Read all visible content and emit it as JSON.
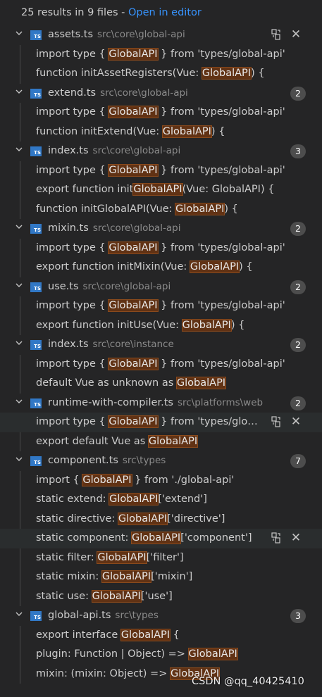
{
  "summary": {
    "count_text": "25 results in 9 files - ",
    "open_label": "Open in editor"
  },
  "files": [
    {
      "name": "assets.ts",
      "path": "src\\core\\global-api",
      "count": "",
      "actions": true,
      "matches": [
        {
          "pre": "import type { ",
          "hl": "GlobalAPI",
          "post": " } from 'types/global-api'"
        },
        {
          "pre": "function initAssetRegisters(Vue: ",
          "hl": "GlobalAPI",
          "post": ") {"
        }
      ]
    },
    {
      "name": "extend.ts",
      "path": "src\\core\\global-api",
      "count": "2",
      "matches": [
        {
          "pre": "import type { ",
          "hl": "GlobalAPI",
          "post": " } from 'types/global-api'"
        },
        {
          "pre": "function initExtend(Vue: ",
          "hl": "GlobalAPI",
          "post": ") {"
        }
      ]
    },
    {
      "name": "index.ts",
      "path": "src\\core\\global-api",
      "count": "3",
      "matches": [
        {
          "pre": "import type { ",
          "hl": "GlobalAPI",
          "post": " } from 'types/global-api'"
        },
        {
          "pre": "export function init",
          "hl": "GlobalAPI",
          "post": "(Vue: GlobalAPI) {"
        },
        {
          "pre": "function initGlobalAPI(Vue: ",
          "hl": "GlobalAPI",
          "post": ") {"
        }
      ]
    },
    {
      "name": "mixin.ts",
      "path": "src\\core\\global-api",
      "count": "2",
      "matches": [
        {
          "pre": "import type { ",
          "hl": "GlobalAPI",
          "post": " } from 'types/global-api'"
        },
        {
          "pre": "export function initMixin(Vue: ",
          "hl": "GlobalAPI",
          "post": ") {"
        }
      ]
    },
    {
      "name": "use.ts",
      "path": "src\\core\\global-api",
      "count": "2",
      "matches": [
        {
          "pre": "import type { ",
          "hl": "GlobalAPI",
          "post": " } from 'types/global-api'"
        },
        {
          "pre": "export function initUse(Vue: ",
          "hl": "GlobalAPI",
          "post": ") {"
        }
      ]
    },
    {
      "name": "index.ts",
      "path": "src\\core\\instance",
      "count": "2",
      "matches": [
        {
          "pre": "import type { ",
          "hl": "GlobalAPI",
          "post": " } from 'types/global-api'"
        },
        {
          "pre": "default Vue as unknown as ",
          "hl": "GlobalAPI",
          "post": ""
        }
      ]
    },
    {
      "name": "runtime-with-compiler.ts",
      "path": "src\\platforms\\web",
      "count": "2",
      "matches": [
        {
          "pre": "import type { ",
          "hl": "GlobalAPI",
          "post": " } from 'types/globa...",
          "selected": true
        },
        {
          "pre": "export default Vue as ",
          "hl": "GlobalAPI",
          "post": ""
        }
      ]
    },
    {
      "name": "component.ts",
      "path": "src\\types",
      "count": "7",
      "matches": [
        {
          "pre": "import { ",
          "hl": "GlobalAPI",
          "post": " } from './global-api'"
        },
        {
          "pre": "static extend: ",
          "hl": "GlobalAPI",
          "post": "['extend']"
        },
        {
          "pre": "static directive: ",
          "hl": "GlobalAPI",
          "post": "['directive']"
        },
        {
          "pre": "static component: ",
          "hl": "GlobalAPI",
          "post": "['component']",
          "selected": true
        },
        {
          "pre": "static filter: ",
          "hl": "GlobalAPI",
          "post": "['filter']"
        },
        {
          "pre": "static mixin: ",
          "hl": "GlobalAPI",
          "post": "['mixin']"
        },
        {
          "pre": "static use: ",
          "hl": "GlobalAPI",
          "post": "['use']"
        }
      ]
    },
    {
      "name": "global-api.ts",
      "path": "src\\types",
      "count": "3",
      "matches": [
        {
          "pre": "export interface ",
          "hl": "GlobalAPI",
          "post": " {"
        },
        {
          "pre": "plugin: Function | Object) => ",
          "hl": "GlobalAPI",
          "post": ""
        },
        {
          "pre": "mixin: (mixin: Object) => ",
          "hl": "GlobalAPI",
          "post": ""
        }
      ]
    }
  ],
  "icons": {
    "file": "typescript-file-icon",
    "expand": "chevron-down-icon",
    "replace": "replace-all-icon",
    "dismiss": "close-icon"
  },
  "icon_label": "TS",
  "watermark": "CSDN @qq_40425410",
  "colors": {
    "highlight": "#613214",
    "link": "#3794ff",
    "ts_icon": "#3178c6",
    "background": "#252526"
  }
}
